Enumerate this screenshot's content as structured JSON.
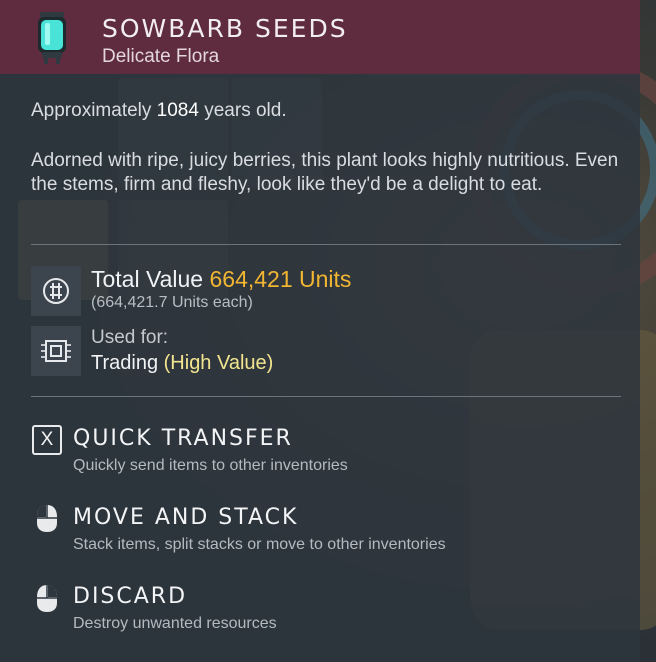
{
  "item": {
    "name": "Sowbarb Seeds",
    "category": "Delicate Flora",
    "icon": "glowing-seed-capsule-icon"
  },
  "age": {
    "prefix": "Approximately",
    "value": "1084",
    "suffix": "years old."
  },
  "description": "Adorned with ripe, juicy berries, this plant looks highly nutritious. Even the stems, firm and fleshy, look like they'd be a delight to eat.",
  "value": {
    "label": "Total Value",
    "amount": "664,421 Units",
    "each": "(664,421.7 Units each)",
    "icon": "units-currency-icon"
  },
  "usage": {
    "label": "Used for:",
    "use": "Trading",
    "qualifier": "(High Value)",
    "icon": "chip-icon"
  },
  "actions": [
    {
      "key": "X",
      "title": "Quick Transfer",
      "desc": "Quickly send items to other inventories",
      "icon": "x-key-icon"
    },
    {
      "title": "Move and Stack",
      "desc": "Stack items, split stacks or move to other inventories",
      "icon": "mouse-left-click-icon"
    },
    {
      "title": "Discard",
      "desc": "Destroy unwanted resources",
      "icon": "mouse-right-click-icon"
    }
  ],
  "colors": {
    "header": "#5f2b3e",
    "units": "#f2b632",
    "highlight": "#f3e58f",
    "seed": "#49e3d8"
  }
}
